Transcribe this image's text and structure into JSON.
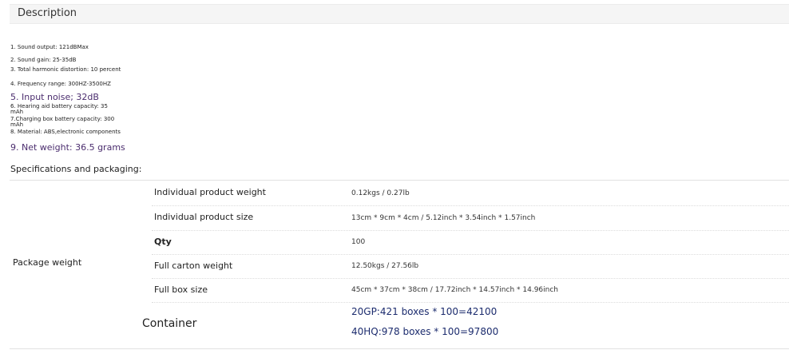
{
  "header": {
    "title": "Description"
  },
  "specs": [
    "1. Sound output: 121dBMax",
    "2. Sound gain: 25-35dB",
    "3. Total harmonic distortion: 10 percent",
    "4. Frequency range: 300HZ-3500HZ",
    "5. Input noise; 32dB",
    "6. Hearing aid battery capacity: 35 mAh",
    "7.Charging box battery capacity: 300 mAh",
    "8. Material: ABS,electronic components",
    "9. Net weight: 36.5 grams"
  ],
  "packaging": {
    "title": "Specifications and packaging:",
    "group_label": "Package weight",
    "rows": [
      {
        "label": "Individual product weight",
        "value": "0.12kgs / 0.27lb"
      },
      {
        "label": "Individual product size",
        "value": "13cm * 9cm * 4cm / 5.12inch * 3.54inch * 1.57inch"
      },
      {
        "label": "Qty",
        "value": "100"
      },
      {
        "label": "Full carton weight",
        "value": "12.50kgs / 27.56lb"
      },
      {
        "label": "Full box size",
        "value": "45cm * 37cm * 38cm / 17.72inch * 14.57inch * 14.96inch"
      }
    ],
    "container": {
      "label": "Container",
      "values": [
        "20GP:421 boxes * 100=42100",
        "40HQ:978 boxes * 100=97800"
      ]
    }
  }
}
